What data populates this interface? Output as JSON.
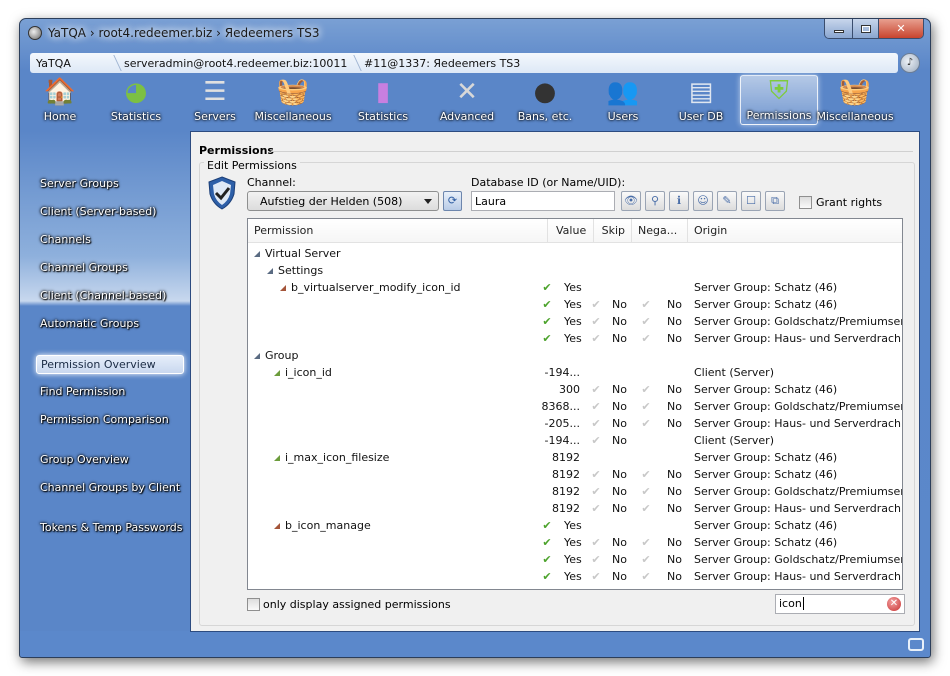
{
  "window": {
    "title": "YaTQA › root4.redeemer.biz › Яedeemers TS3",
    "controls": {
      "minimize": "minimize",
      "maximize": "maximize",
      "close": "✕"
    }
  },
  "breadcrumb": [
    "YaTQA",
    "serveradmin@root4.redeemer.biz:10011",
    "#11@1337: Яedeemers TS3"
  ],
  "toolbar": [
    {
      "label": "Home",
      "icon": "home-icon"
    },
    {
      "label": "Statistics",
      "icon": "pie-chart-icon"
    },
    {
      "label": "Servers",
      "icon": "server-rack-icon"
    },
    {
      "label": "Miscellaneous",
      "icon": "basket-icon"
    },
    {
      "label": "Statistics",
      "icon": "bar-chart-icon"
    },
    {
      "label": "Advanced",
      "icon": "tools-icon"
    },
    {
      "label": "Bans, etc.",
      "icon": "banned-user-icon"
    },
    {
      "label": "Users",
      "icon": "users-icon"
    },
    {
      "label": "User DB",
      "icon": "user-cards-icon"
    },
    {
      "label": "Permissions",
      "icon": "shield-icon",
      "active": true
    },
    {
      "label": "Miscellaneous",
      "icon": "basket-purple-icon"
    }
  ],
  "sidebar": [
    {
      "label": "Server Groups"
    },
    {
      "label": "Client (Server-based)"
    },
    {
      "label": "Channels"
    },
    {
      "label": "Channel Groups"
    },
    {
      "label": "Client (Channel-based)"
    },
    {
      "label": "Automatic Groups"
    },
    {
      "label": "Permission Overview",
      "active": true
    },
    {
      "label": "Find Permission"
    },
    {
      "label": "Permission Comparison"
    },
    {
      "label": "Group Overview"
    },
    {
      "label": "Channel Groups by Client"
    },
    {
      "label": "Tokens & Temp Passwords"
    }
  ],
  "panel": {
    "title": "Permissions",
    "group_title": "Edit Permissions",
    "channel_label": "Channel:",
    "channel_value": "Aufstieg der Helden (508)",
    "dbid_label": "Database ID (or Name/UID):",
    "dbid_value": "Laura",
    "grant_rights_label": "Grant rights",
    "grant_rights_checked": false,
    "icon_buttons": [
      "view-icon",
      "group-search-icon",
      "info-icon",
      "group-icon",
      "edit-user-icon",
      "user-card-icon",
      "copy-icon"
    ],
    "columns": [
      "Permission",
      "Value",
      "Skip",
      "Nega...",
      "Origin"
    ],
    "rows": [
      {
        "type": "cat",
        "indent": 0,
        "name": "Virtual Server"
      },
      {
        "type": "cat",
        "indent": 1,
        "name": "Settings"
      },
      {
        "type": "perm",
        "indent": 2,
        "name": "b_virtualserver_modify_icon_id",
        "color": "red",
        "check": true,
        "value": "Yes",
        "skip": "",
        "neg": "",
        "origin": "Server Group: Schatz (46)"
      },
      {
        "type": "sub",
        "check": true,
        "value": "Yes",
        "skip": "No",
        "neg": "No",
        "origin": "Server Group: Schatz (46)"
      },
      {
        "type": "sub",
        "check": true,
        "value": "Yes",
        "skip": "No",
        "neg": "No",
        "origin": "Server Group: Goldschatz/Premiumser..."
      },
      {
        "type": "sub",
        "check": true,
        "value": "Yes",
        "skip": "No",
        "neg": "No",
        "origin": "Server Group: Haus- und Serverdrach..."
      },
      {
        "type": "cat",
        "indent": 0,
        "name": "Group"
      },
      {
        "type": "perm",
        "indent": 1,
        "name": "i_icon_id",
        "color": "green",
        "check": false,
        "value": "-194...",
        "skip": "",
        "neg": "",
        "origin": "Client (Server)"
      },
      {
        "type": "sub",
        "check": false,
        "value": "300",
        "skip": "No",
        "neg": "No",
        "origin": "Server Group: Schatz (46)"
      },
      {
        "type": "sub",
        "check": false,
        "value": "8368...",
        "skip": "No",
        "neg": "No",
        "origin": "Server Group: Goldschatz/Premiumser..."
      },
      {
        "type": "sub",
        "check": false,
        "value": "-205...",
        "skip": "No",
        "neg": "No",
        "origin": "Server Group: Haus- und Serverdrach..."
      },
      {
        "type": "sub",
        "check": false,
        "value": "-194...",
        "skip": "No",
        "neg": "",
        "origin": "Client (Server)"
      },
      {
        "type": "perm",
        "indent": 1,
        "name": "i_max_icon_filesize",
        "color": "green",
        "check": false,
        "value": "8192",
        "skip": "",
        "neg": "",
        "origin": "Server Group: Schatz (46)"
      },
      {
        "type": "sub",
        "check": false,
        "value": "8192",
        "skip": "No",
        "neg": "No",
        "origin": "Server Group: Schatz (46)"
      },
      {
        "type": "sub",
        "check": false,
        "value": "8192",
        "skip": "No",
        "neg": "No",
        "origin": "Server Group: Goldschatz/Premiumser..."
      },
      {
        "type": "sub",
        "check": false,
        "value": "8192",
        "skip": "No",
        "neg": "No",
        "origin": "Server Group: Haus- und Serverdrach..."
      },
      {
        "type": "perm",
        "indent": 1,
        "name": "b_icon_manage",
        "color": "red",
        "check": true,
        "value": "Yes",
        "skip": "",
        "neg": "",
        "origin": "Server Group: Schatz (46)"
      },
      {
        "type": "sub",
        "check": true,
        "value": "Yes",
        "skip": "No",
        "neg": "No",
        "origin": "Server Group: Schatz (46)"
      },
      {
        "type": "sub",
        "check": true,
        "value": "Yes",
        "skip": "No",
        "neg": "No",
        "origin": "Server Group: Goldschatz/Premiumser..."
      },
      {
        "type": "sub",
        "check": true,
        "value": "Yes",
        "skip": "No",
        "neg": "No",
        "origin": "Server Group: Haus- und Serverdrach..."
      }
    ],
    "only_assigned_label": "only display assigned permissions",
    "only_assigned_checked": false,
    "search_value": "icon"
  },
  "colors": {
    "accent": "#5a86c8",
    "check_green": "#4ca32c",
    "close_red": "#c8442e"
  }
}
